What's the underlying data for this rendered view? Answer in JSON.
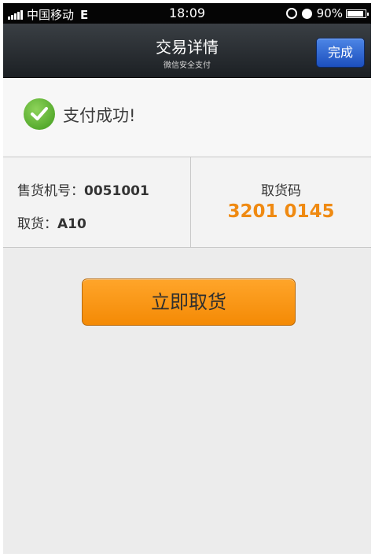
{
  "status_bar": {
    "carrier": "中国移动",
    "network": "E",
    "time": "18:09",
    "battery": "90%",
    "battery_level": 0.9
  },
  "nav": {
    "title": "交易详情",
    "subtitle": "微信安全支付",
    "done_label": "完成"
  },
  "result": {
    "message": "支付成功!",
    "icon": "check-circle-icon",
    "icon_color": "#4caf27"
  },
  "order": {
    "machine_label": "售货机号：",
    "machine_value": "0051001",
    "slot_label": "取货：",
    "slot_value": "A10",
    "code_label": "取货码",
    "code_value": "3201 0145",
    "code_color": "#ef8a12"
  },
  "action": {
    "pickup_label": "立即取货",
    "color": "#f7941d"
  }
}
